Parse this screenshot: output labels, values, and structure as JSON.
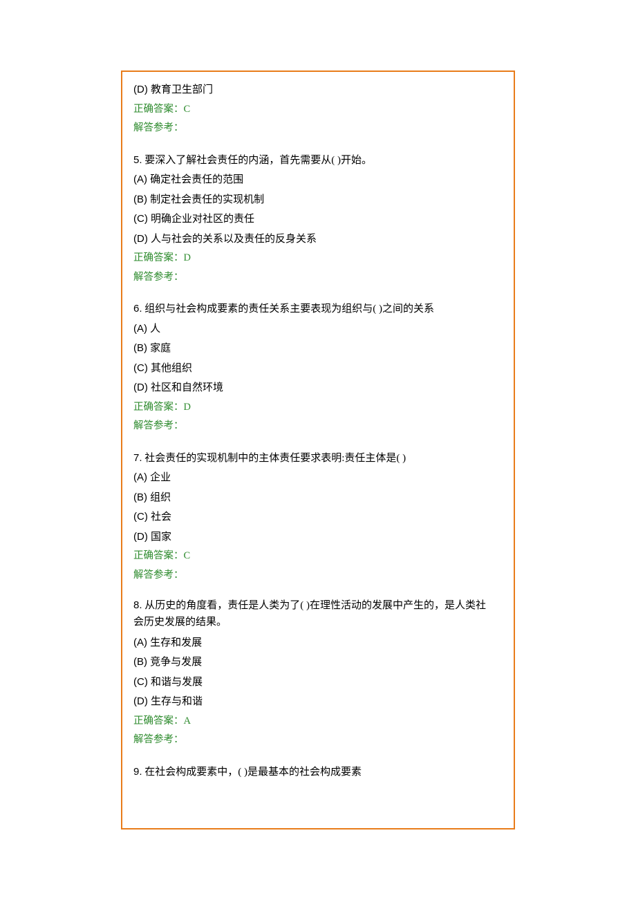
{
  "labels": {
    "correct_answer_prefix": "正确答案：",
    "reference_prefix": "解答参考："
  },
  "q4_tail": {
    "options": [
      {
        "letter": "(D)",
        "text": " 教育卫生部门"
      }
    ],
    "answer": "C"
  },
  "q5": {
    "number": "5.",
    "title": " 要深入了解社会责任的内涵，首先需要从(  )开始。",
    "options": [
      {
        "letter": "(A)",
        "text": " 确定社会责任的范围"
      },
      {
        "letter": "(B)",
        "text": " 制定社会责任的实现机制"
      },
      {
        "letter": "(C)",
        "text": " 明确企业对社区的责任"
      },
      {
        "letter": "(D)",
        "text": " 人与社会的关系以及责任的反身关系"
      }
    ],
    "answer": "D"
  },
  "q6": {
    "number": "6.",
    "title": " 组织与社会构成要素的责任关系主要表现为组织与(  )之间的关系",
    "options": [
      {
        "letter": "(A)",
        "text": " 人"
      },
      {
        "letter": "(B)",
        "text": " 家庭"
      },
      {
        "letter": "(C)",
        "text": " 其他组织"
      },
      {
        "letter": "(D)",
        "text": " 社区和自然环境"
      }
    ],
    "answer": "D"
  },
  "q7": {
    "number": "7.",
    "title": " 社会责任的实现机制中的主体责任要求表明:责任主体是(  )",
    "options": [
      {
        "letter": "(A)",
        "text": " 企业"
      },
      {
        "letter": "(B)",
        "text": " 组织"
      },
      {
        "letter": "(C)",
        "text": " 社会"
      },
      {
        "letter": "(D)",
        "text": " 国家"
      }
    ],
    "answer": "C"
  },
  "q8": {
    "number": "8.",
    "title_line1": " 从历史的角度看，责任是人类为了(  )在理性活动的发展中产生的，是人类社",
    "title_line2": "会历史发展的结果。",
    "options": [
      {
        "letter": "(A)",
        "text": " 生存和发展"
      },
      {
        "letter": "(B)",
        "text": " 竞争与发展"
      },
      {
        "letter": "(C)",
        "text": " 和谐与发展"
      },
      {
        "letter": "(D)",
        "text": " 生存与和谐"
      }
    ],
    "answer": "A"
  },
  "q9": {
    "number": "9.",
    "title": " 在社会构成要素中，(  )是最基本的社会构成要素"
  }
}
